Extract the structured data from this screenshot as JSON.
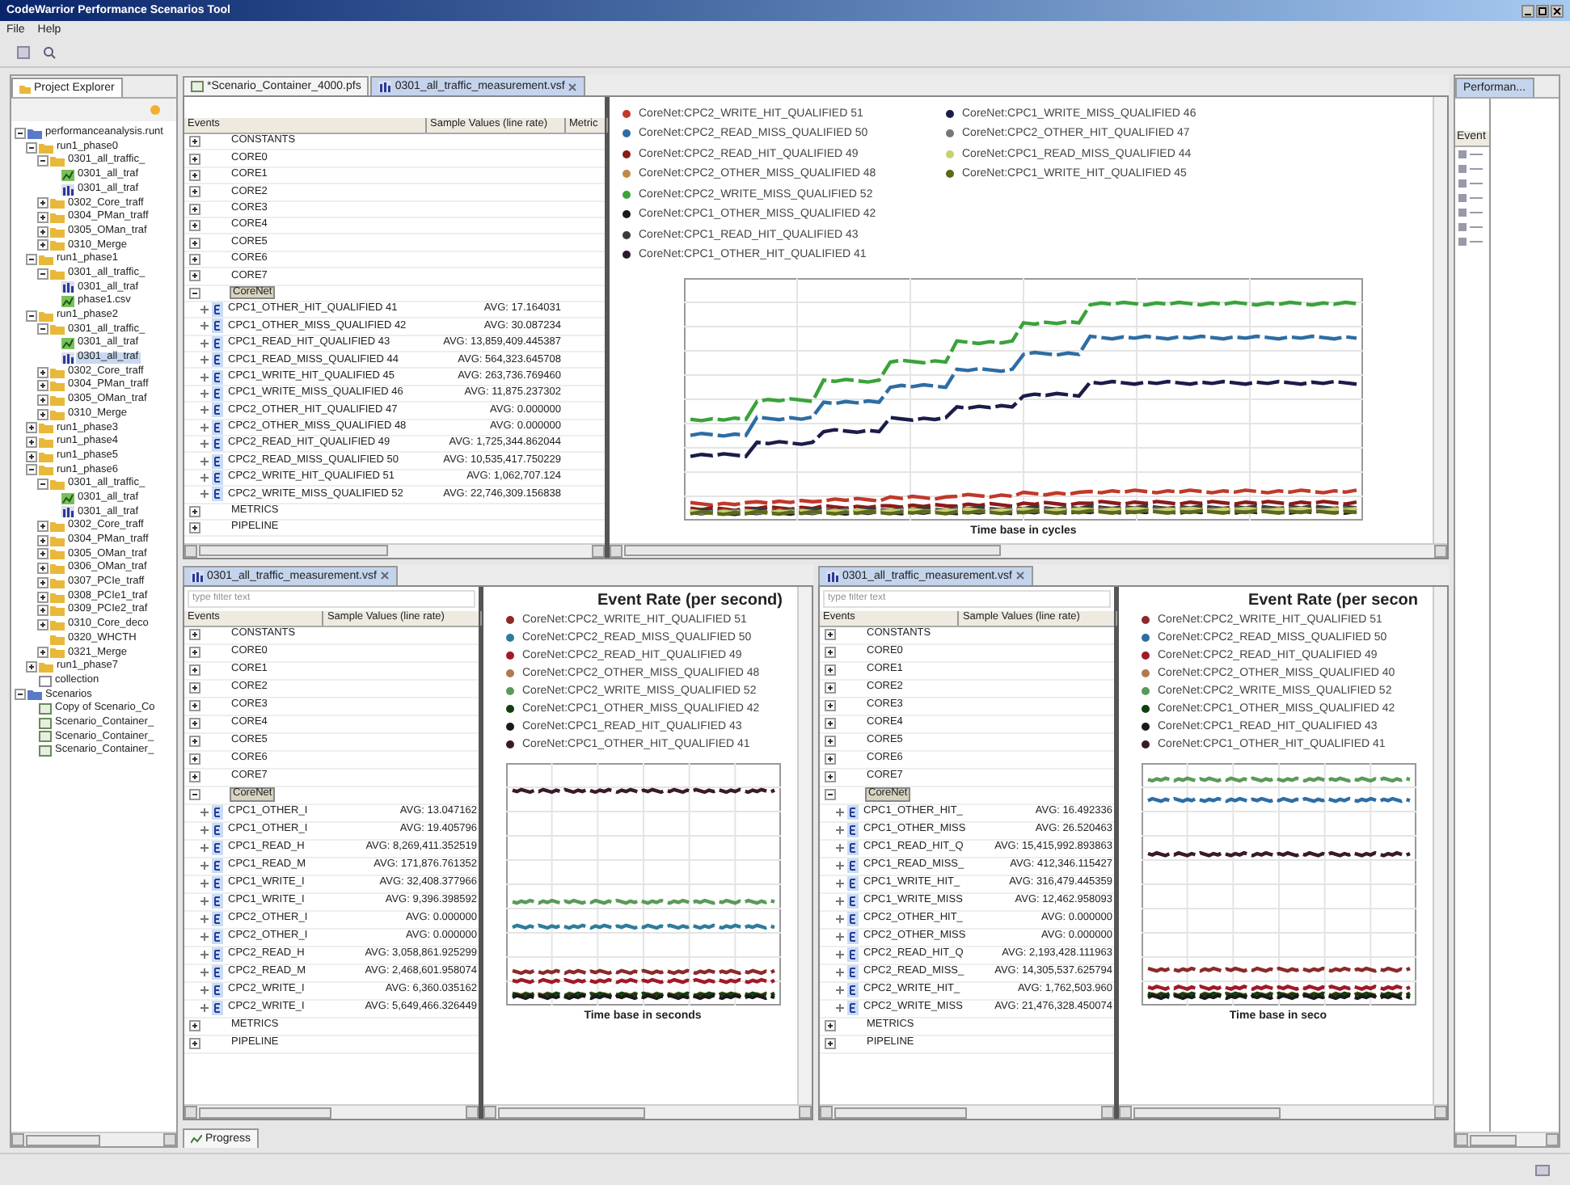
{
  "window": {
    "title": "CodeWarrior Performance Scenarios Tool"
  },
  "menu": [
    "File",
    "Help"
  ],
  "project_explorer": {
    "tab": "Project Explorer",
    "tree": [
      {
        "label": "performanceanalysis.runt",
        "kind": "project",
        "expanded": true,
        "children": [
          {
            "label": "run1_phase0",
            "kind": "folder",
            "expanded": true,
            "children": [
              {
                "label": "0301_all_traffic_",
                "kind": "folder",
                "expanded": true,
                "children": [
                  {
                    "label": "0301_all_traf",
                    "kind": "chart"
                  },
                  {
                    "label": "0301_all_traf",
                    "kind": "data"
                  }
                ]
              },
              {
                "label": "0302_Core_traff",
                "kind": "folder",
                "expanded": false
              },
              {
                "label": "0304_PMan_traff",
                "kind": "folder",
                "expanded": false
              },
              {
                "label": "0305_OMan_traf",
                "kind": "folder",
                "expanded": false
              },
              {
                "label": "0310_Merge",
                "kind": "folder",
                "expanded": false
              }
            ]
          },
          {
            "label": "run1_phase1",
            "kind": "folder",
            "expanded": true,
            "children": [
              {
                "label": "0301_all_traffic_",
                "kind": "folder",
                "expanded": true,
                "children": [
                  {
                    "label": "0301_all_traf",
                    "kind": "data"
                  },
                  {
                    "label": "phase1.csv",
                    "kind": "chart"
                  }
                ]
              }
            ]
          },
          {
            "label": "run1_phase2",
            "kind": "folder",
            "expanded": true,
            "children": [
              {
                "label": "0301_all_traffic_",
                "kind": "folder",
                "expanded": true,
                "children": [
                  {
                    "label": "0301_all_traf",
                    "kind": "chart"
                  },
                  {
                    "label": "0301_all_traf",
                    "kind": "data",
                    "selected": true
                  }
                ]
              },
              {
                "label": "0302_Core_traff",
                "kind": "folder",
                "expanded": false
              },
              {
                "label": "0304_PMan_traff",
                "kind": "folder",
                "expanded": false
              },
              {
                "label": "0305_OMan_traf",
                "kind": "folder",
                "expanded": false
              },
              {
                "label": "0310_Merge",
                "kind": "folder",
                "expanded": false
              }
            ]
          },
          {
            "label": "run1_phase3",
            "kind": "folder",
            "expanded": false
          },
          {
            "label": "run1_phase4",
            "kind": "folder",
            "expanded": false
          },
          {
            "label": "run1_phase5",
            "kind": "folder",
            "expanded": false
          },
          {
            "label": "run1_phase6",
            "kind": "folder",
            "expanded": true,
            "children": [
              {
                "label": "0301_all_traffic_",
                "kind": "folder",
                "expanded": true,
                "children": [
                  {
                    "label": "0301_all_traf",
                    "kind": "chart"
                  },
                  {
                    "label": "0301_all_traf",
                    "kind": "data"
                  }
                ]
              },
              {
                "label": "0302_Core_traff",
                "kind": "folder",
                "expanded": false
              },
              {
                "label": "0304_PMan_traff",
                "kind": "folder",
                "expanded": false
              },
              {
                "label": "0305_OMan_traf",
                "kind": "folder",
                "expanded": false
              },
              {
                "label": "0306_OMan_traf",
                "kind": "folder",
                "expanded": false
              },
              {
                "label": "0307_PCIe_traff",
                "kind": "folder",
                "expanded": false
              },
              {
                "label": "0308_PCIe1_traf",
                "kind": "folder",
                "expanded": false
              },
              {
                "label": "0309_PCIe2_traf",
                "kind": "folder",
                "expanded": false
              },
              {
                "label": "0310_Core_deco",
                "kind": "folder",
                "expanded": false
              },
              {
                "label": "0320_WHCTH",
                "kind": "folder"
              },
              {
                "label": "0321_Merge",
                "kind": "folder",
                "expanded": false
              }
            ]
          },
          {
            "label": "run1_phase7",
            "kind": "folder",
            "expanded": false
          },
          {
            "label": "collection",
            "kind": "file"
          }
        ]
      },
      {
        "label": "Scenarios",
        "kind": "project",
        "expanded": true,
        "children": [
          {
            "label": "Copy of Scenario_Co",
            "kind": "scenario"
          },
          {
            "label": "Scenario_Container_",
            "kind": "scenario"
          },
          {
            "label": "Scenario_Container_",
            "kind": "scenario"
          },
          {
            "label": "Scenario_Container_",
            "kind": "scenario"
          }
        ]
      }
    ]
  },
  "editors": [
    {
      "tabs": [
        {
          "label": "*Scenario_Container_4000.pfs",
          "kind": "scenario",
          "selected": false
        },
        {
          "label": "0301_all_traffic_measurement.vsf",
          "kind": "data",
          "selected": true
        }
      ],
      "table": {
        "columns": [
          "Events",
          "Sample Values (line rate)",
          "Metric"
        ],
        "rows": [
          {
            "label": "CONSTANTS",
            "expanded": false,
            "selected": false
          },
          {
            "label": "CORE0",
            "expanded": false,
            "selected": false
          },
          {
            "label": "CORE1",
            "expanded": false,
            "selected": false
          },
          {
            "label": "CORE2",
            "expanded": false,
            "selected": false
          },
          {
            "label": "CORE3",
            "expanded": false,
            "selected": false
          },
          {
            "label": "CORE4",
            "expanded": false,
            "selected": false
          },
          {
            "label": "CORE5",
            "expanded": false,
            "selected": false
          },
          {
            "label": "CORE6",
            "expanded": false,
            "selected": false
          },
          {
            "label": "CORE7",
            "expanded": false,
            "selected": false
          },
          {
            "label": "CoreNet",
            "expanded": true,
            "selected": true,
            "children": [
              {
                "label": "CPC1_OTHER_HIT_QUALIFIED 41",
                "value": "AVG: 17.164031"
              },
              {
                "label": "CPC1_OTHER_MISS_QUALIFIED 42",
                "value": "AVG: 30.087234"
              },
              {
                "label": "CPC1_READ_HIT_QUALIFIED 43",
                "value": "AVG: 13,859,409.445387"
              },
              {
                "label": "CPC1_READ_MISS_QUALIFIED 44",
                "value": "AVG: 564,323.645708"
              },
              {
                "label": "CPC1_WRITE_HIT_QUALIFIED 45",
                "value": "AVG: 263,736.769460"
              },
              {
                "label": "CPC1_WRITE_MISS_QUALIFIED 46",
                "value": "AVG: 11,875.237302"
              },
              {
                "label": "CPC2_OTHER_HIT_QUALIFIED 47",
                "value": "AVG: 0.000000"
              },
              {
                "label": "CPC2_OTHER_MISS_QUALIFIED 48",
                "value": "AVG: 0.000000"
              },
              {
                "label": "CPC2_READ_HIT_QUALIFIED 49",
                "value": "AVG: 1,725,344.862044"
              },
              {
                "label": "CPC2_READ_MISS_QUALIFIED 50",
                "value": "AVG: 10,535,417.750229"
              },
              {
                "label": "CPC2_WRITE_HIT_QUALIFIED 51",
                "value": "AVG: 1,062,707.124"
              },
              {
                "label": "CPC2_WRITE_MISS_QUALIFIED 52",
                "value": "AVG: 22,746,309.156838"
              }
            ]
          },
          {
            "label": "METRICS",
            "expanded": false,
            "selected": false
          },
          {
            "label": "PIPELINE",
            "expanded": false,
            "selected": false
          }
        ]
      },
      "chart": {
        "xlabel": "Time base in cycles",
        "legend": [
          {
            "label": "CoreNet:CPC2_WRITE_HIT_QUALIFIED 51",
            "color": "#c0392b"
          },
          {
            "label": "CoreNet:CPC2_READ_MISS_QUALIFIED 50",
            "color": "#2e6da4"
          },
          {
            "label": "CoreNet:CPC2_READ_HIT_QUALIFIED 49",
            "color": "#8b1a1a"
          },
          {
            "label": "CoreNet:CPC2_OTHER_MISS_QUALIFIED 48",
            "color": "#c08a4a"
          },
          {
            "label": "CoreNet:CPC2_WRITE_MISS_QUALIFIED 52",
            "color": "#3aa33a"
          },
          {
            "label": "CoreNet:CPC1_OTHER_MISS_QUALIFIED 42",
            "color": "#1a1a1a"
          },
          {
            "label": "CoreNet:CPC1_READ_HIT_QUALIFIED 43",
            "color": "#3a3a3a"
          },
          {
            "label": "CoreNet:CPC1_OTHER_HIT_QUALIFIED 41",
            "color": "#2b1a2b"
          },
          {
            "label": "CoreNet:CPC1_WRITE_MISS_QUALIFIED 46",
            "color": "#1c1c4a"
          },
          {
            "label": "CoreNet:CPC2_OTHER_HIT_QUALIFIED 47",
            "color": "#777777"
          },
          {
            "label": "CoreNet:CPC1_READ_MISS_QUALIFIED 44",
            "color": "#c8d070"
          },
          {
            "label": "CoreNet:CPC1_WRITE_HIT_QUALIFIED 45",
            "color": "#5a6a1a"
          }
        ]
      }
    },
    {
      "tabs": [
        {
          "label": "0301_all_traffic_measurement.vsf",
          "kind": "data",
          "selected": true
        }
      ],
      "filter": {
        "placeholder": "type filter text"
      },
      "table": {
        "columns": [
          "Events",
          "Sample Values (line rate)"
        ],
        "rows": [
          {
            "label": "CONSTANTS",
            "expanded": false,
            "selected": false
          },
          {
            "label": "CORE0",
            "expanded": false,
            "selected": false
          },
          {
            "label": "CORE1",
            "expanded": false,
            "selected": false
          },
          {
            "label": "CORE2",
            "expanded": false,
            "selected": false
          },
          {
            "label": "CORE3",
            "expanded": false,
            "selected": false
          },
          {
            "label": "CORE4",
            "expanded": false,
            "selected": false
          },
          {
            "label": "CORE5",
            "expanded": false,
            "selected": false
          },
          {
            "label": "CORE6",
            "expanded": false,
            "selected": false
          },
          {
            "label": "CORE7",
            "expanded": false,
            "selected": false
          },
          {
            "label": "CoreNet",
            "expanded": true,
            "selected": true,
            "children": [
              {
                "label": "CPC1_OTHER_I",
                "value": "AVG: 13.047162"
              },
              {
                "label": "CPC1_OTHER_I",
                "value": "AVG: 19.405796"
              },
              {
                "label": "CPC1_READ_H",
                "value": "AVG: 8,269,411.352519"
              },
              {
                "label": "CPC1_READ_M",
                "value": "AVG: 171,876.761352"
              },
              {
                "label": "CPC1_WRITE_I",
                "value": "AVG: 32,408.377966"
              },
              {
                "label": "CPC1_WRITE_I",
                "value": "AVG: 9,396.398592"
              },
              {
                "label": "CPC2_OTHER_I",
                "value": "AVG: 0.000000"
              },
              {
                "label": "CPC2_OTHER_I",
                "value": "AVG: 0.000000"
              },
              {
                "label": "CPC2_READ_H",
                "value": "AVG: 3,058,861.925299"
              },
              {
                "label": "CPC2_READ_M",
                "value": "AVG: 2,468,601.958074"
              },
              {
                "label": "CPC2_WRITE_I",
                "value": "AVG: 6,360.035162"
              },
              {
                "label": "CPC2_WRITE_I",
                "value": "AVG: 5,649,466.326449"
              }
            ]
          },
          {
            "label": "METRICS",
            "expanded": false,
            "selected": false
          },
          {
            "label": "PIPELINE",
            "expanded": false,
            "selected": false
          }
        ]
      },
      "chart": {
        "title": "Event Rate (per second)",
        "xlabel": "Time base in seconds",
        "legend": [
          {
            "label": "CoreNet:CPC2_WRITE_HIT_QUALIFIED 51",
            "color": "#8b2a2a"
          },
          {
            "label": "CoreNet:CPC2_READ_MISS_QUALIFIED 50",
            "color": "#2e7d9a"
          },
          {
            "label": "CoreNet:CPC2_READ_HIT_QUALIFIED 49",
            "color": "#a01a2a"
          },
          {
            "label": "CoreNet:CPC2_OTHER_MISS_QUALIFIED 48",
            "color": "#b07a50"
          },
          {
            "label": "CoreNet:CPC2_WRITE_MISS_QUALIFIED 52",
            "color": "#5a9a5a"
          },
          {
            "label": "CoreNet:CPC1_OTHER_MISS_QUALIFIED 42",
            "color": "#104010"
          },
          {
            "label": "CoreNet:CPC1_READ_HIT_QUALIFIED 43",
            "color": "#1a1a1a"
          },
          {
            "label": "CoreNet:CPC1_OTHER_HIT_QUALIFIED 41",
            "color": "#3a1a2a"
          }
        ]
      }
    },
    {
      "tabs": [
        {
          "label": "0301_all_traffic_measurement.vsf",
          "kind": "data",
          "selected": true
        }
      ],
      "filter": {
        "placeholder": "type filter text"
      },
      "table": {
        "columns": [
          "Events",
          "Sample Values (line rate)"
        ],
        "rows": [
          {
            "label": "CONSTANTS",
            "expanded": false,
            "selected": false
          },
          {
            "label": "CORE0",
            "expanded": false,
            "selected": false
          },
          {
            "label": "CORE1",
            "expanded": false,
            "selected": false
          },
          {
            "label": "CORE2",
            "expanded": false,
            "selected": false
          },
          {
            "label": "CORE3",
            "expanded": false,
            "selected": false
          },
          {
            "label": "CORE4",
            "expanded": false,
            "selected": false
          },
          {
            "label": "CORE5",
            "expanded": false,
            "selected": false
          },
          {
            "label": "CORE6",
            "expanded": false,
            "selected": false
          },
          {
            "label": "CORE7",
            "expanded": false,
            "selected": false
          },
          {
            "label": "CoreNet",
            "expanded": true,
            "selected": true,
            "children": [
              {
                "label": "CPC1_OTHER_HIT_",
                "value": "AVG: 16.492336"
              },
              {
                "label": "CPC1_OTHER_MISS",
                "value": "AVG: 26.520463"
              },
              {
                "label": "CPC1_READ_HIT_Q",
                "value": "AVG: 15,415,992.893863"
              },
              {
                "label": "CPC1_READ_MISS_",
                "value": "AVG: 412,346.115427"
              },
              {
                "label": "CPC1_WRITE_HIT_",
                "value": "AVG: 316,479.445359"
              },
              {
                "label": "CPC1_WRITE_MISS",
                "value": "AVG: 12,462.958093"
              },
              {
                "label": "CPC2_OTHER_HIT_",
                "value": "AVG: 0.000000"
              },
              {
                "label": "CPC2_OTHER_MISS",
                "value": "AVG: 0.000000"
              },
              {
                "label": "CPC2_READ_HIT_Q",
                "value": "AVG: 2,193,428.111963"
              },
              {
                "label": "CPC2_READ_MISS_",
                "value": "AVG: 14,305,537.625794"
              },
              {
                "label": "CPC2_WRITE_HIT_",
                "value": "AVG: 1,762,503.960"
              },
              {
                "label": "CPC2_WRITE_MISS",
                "value": "AVG: 21,476,328.450074"
              }
            ]
          },
          {
            "label": "METRICS",
            "expanded": false,
            "selected": false
          },
          {
            "label": "PIPELINE",
            "expanded": false,
            "selected": false
          }
        ]
      },
      "chart": {
        "title": "Event Rate (per secon",
        "xlabel": "Time base in seco",
        "legend": [
          {
            "label": "CoreNet:CPC2_WRITE_HIT_QUALIFIED 51",
            "color": "#8b2a2a"
          },
          {
            "label": "CoreNet:CPC2_READ_MISS_QUALIFIED 50",
            "color": "#2e6da4"
          },
          {
            "label": "CoreNet:CPC2_READ_HIT_QUALIFIED 49",
            "color": "#a01a2a"
          },
          {
            "label": "CoreNet:CPC2_OTHER_MISS_QUALIFIED 40",
            "color": "#b07a50"
          },
          {
            "label": "CoreNet:CPC2_WRITE_MISS_QUALIFIED 52",
            "color": "#5a9a5a"
          },
          {
            "label": "CoreNet:CPC1_OTHER_MISS_QUALIFIED 42",
            "color": "#104010"
          },
          {
            "label": "CoreNet:CPC1_READ_HIT_QUALIFIED 43",
            "color": "#1a1a1a"
          },
          {
            "label": "CoreNet:CPC1_OTHER_HIT_QUALIFIED 41",
            "color": "#3a1a2a"
          }
        ]
      }
    }
  ],
  "side_panel": {
    "tab": "Performan...",
    "column": "Event"
  },
  "bottom_tab": "Progress"
}
